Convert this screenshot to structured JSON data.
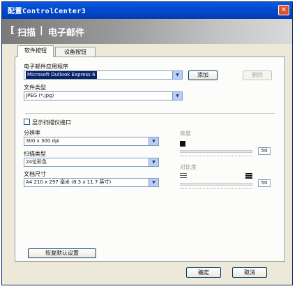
{
  "window": {
    "title": "配置ControlCenter3",
    "close_glyph": "✕"
  },
  "header": {
    "section": "扫描",
    "separator": "|",
    "subsection": "电子邮件"
  },
  "tabs": [
    {
      "label": "软件按钮",
      "active": true
    },
    {
      "label": "设备按钮",
      "active": false
    }
  ],
  "email_app": {
    "label": "电子邮件应用程序",
    "value": "Microsoft Outlook Express 6",
    "add_label": "添加",
    "delete_label": "删除"
  },
  "file_type": {
    "label": "文件类型",
    "value": "JPEG (*.jpg)"
  },
  "scanner_interface": {
    "label": "显示扫描仪接口",
    "checked": false
  },
  "resolution": {
    "label": "分辨率",
    "value": "300 x 300 dpi"
  },
  "scan_type": {
    "label": "扫描类型",
    "value": "24位彩色"
  },
  "document_size": {
    "label": "文档尺寸",
    "value": "A4 210 x 297 毫米 (8.3 x 11.7 英寸)"
  },
  "brightness": {
    "label": "亮度",
    "value": "50",
    "level": 0.5,
    "icon": "brightness-icon"
  },
  "contrast": {
    "label": "对比度",
    "value": "50",
    "level": 0.5,
    "icon": "contrast-icon"
  },
  "restore_label": "恢复默认设置",
  "ok_label": "确定",
  "cancel_label": "取消",
  "arrow_glyph": "▼",
  "colors": {
    "titlebar": "#0046c8",
    "selection": "#0a246a",
    "close": "#e0502a"
  }
}
